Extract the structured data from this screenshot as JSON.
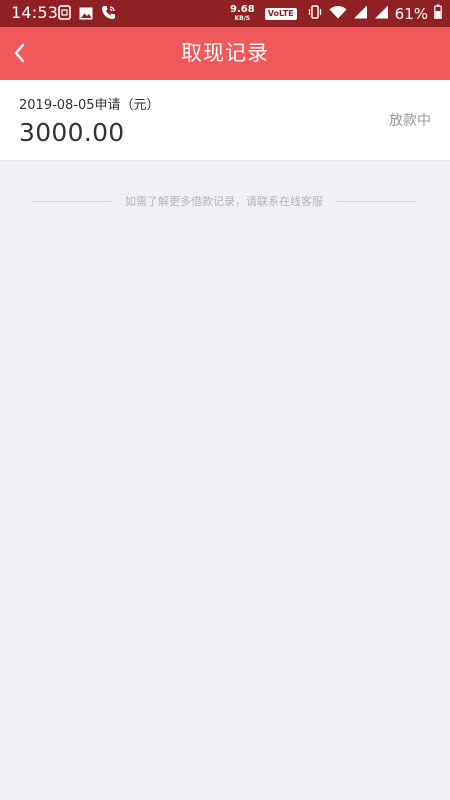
{
  "status_bar": {
    "time": "14:53",
    "net_speed": "9.68",
    "net_speed_unit": "KB/S",
    "network_badge": "VoLTE",
    "battery": "61%",
    "icons": [
      "sim-card-icon",
      "image-icon",
      "phone-call-icon",
      "vibrate-icon",
      "wifi-icon",
      "signal-icon",
      "signal-icon-2",
      "battery-icon"
    ]
  },
  "header": {
    "title": "取现记录",
    "back_icon": "chevron-left-icon"
  },
  "records": [
    {
      "date_label": "2019-08-05申请（元）",
      "amount": "3000.00",
      "status": "放款中"
    }
  ],
  "footer_tip": "如需了解更多借款记录，请联系在线客服",
  "colors": {
    "status_bar": "#8f2024",
    "header": "#f1585a",
    "page_bg": "#efeff4",
    "status_text": "#999999"
  }
}
